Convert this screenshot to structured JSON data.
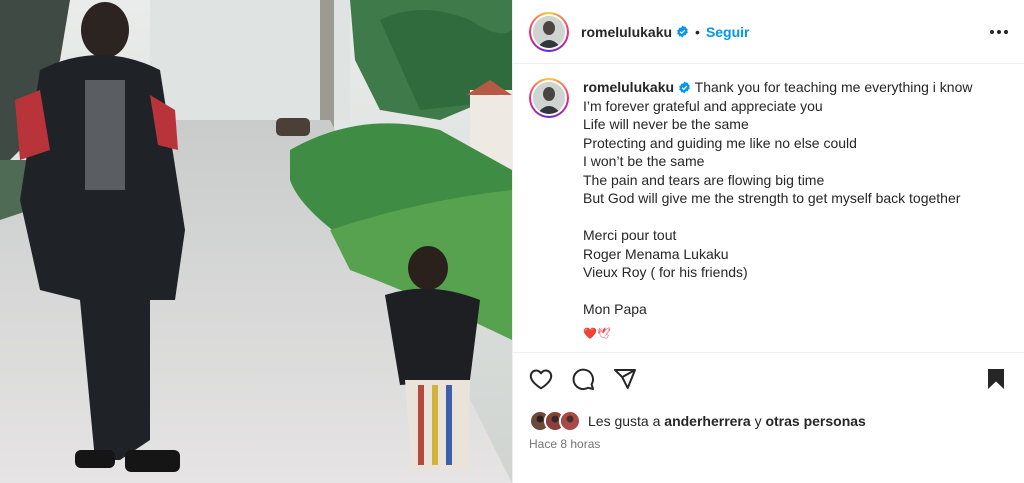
{
  "post": {
    "username": "romelulukaku",
    "dot": "•",
    "follow_label": "Seguir",
    "header_avatar_icon": "profile-avatar",
    "more_icon": "more-options-icon"
  },
  "caption": {
    "username": "romelulukaku",
    "lines": [
      "Thank you for teaching me everything i know",
      "I’m forever grateful and appreciate you",
      "Life will never be the same",
      "Protecting and guiding me like no else could",
      "I won’t be the same",
      "The pain and tears are flowing big time",
      "But God will give me the strength to get myself back together",
      "",
      "Merci pour tout",
      "Roger Menama Lukaku",
      "Vieux Roy ( for his friends)",
      "",
      "Mon Papa"
    ],
    "emoji_hint": "❤️🕊"
  },
  "actions": {
    "icons": [
      "heart-icon",
      "comment-icon",
      "share-icon",
      "bookmark-icon"
    ]
  },
  "likes": {
    "prefix": "Les gusta a",
    "user": "anderherrera",
    "connector": "y",
    "others": "otras personas"
  },
  "time": "Hace 8 horas",
  "colors": {
    "accent": "#0095f6",
    "text": "#262626",
    "muted": "#737373",
    "border": "#efefef"
  }
}
